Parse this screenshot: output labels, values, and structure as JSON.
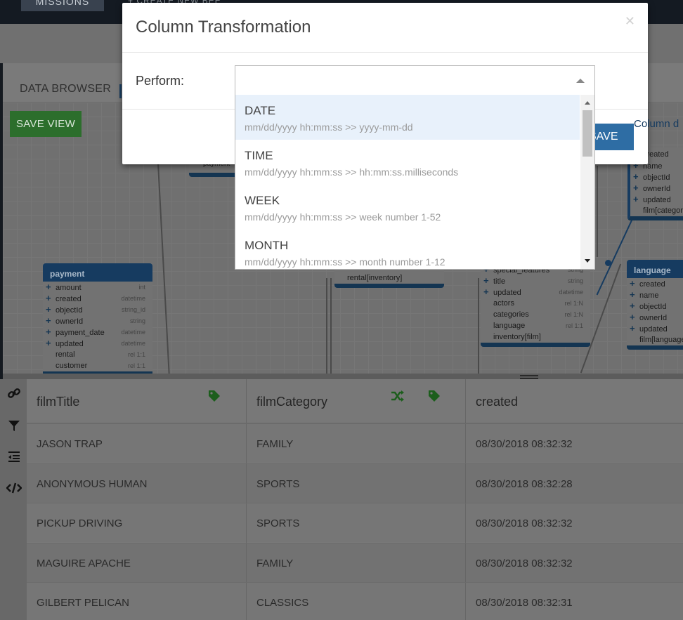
{
  "app": {
    "nav_missions": "MISSIONS",
    "nav_create": "+ CREATE NEW BEE",
    "tab_data_browser": "DATA BROWSER",
    "save_view": "SAVE VIEW"
  },
  "diagram": {
    "payment": {
      "title": "payment",
      "fields": [
        {
          "name": "amount",
          "type": "int",
          "plus": true
        },
        {
          "name": "created",
          "type": "datetime",
          "plus": true
        },
        {
          "name": "objectId",
          "type": "string_id",
          "plus": true
        },
        {
          "name": "ownerId",
          "type": "string",
          "plus": true
        },
        {
          "name": "payment_date",
          "type": "datetime",
          "plus": true
        },
        {
          "name": "updated",
          "type": "datetime",
          "plus": true
        },
        {
          "name": "rental",
          "type": "rel 1:1",
          "plus": false
        },
        {
          "name": "customer",
          "type": "rel 1:1",
          "plus": false
        }
      ]
    },
    "film": {
      "fields": [
        {
          "name": "special_features",
          "type": "string",
          "plus": true
        },
        {
          "name": "title",
          "type": "string",
          "plus": true
        },
        {
          "name": "updated",
          "type": "datetime",
          "plus": true
        },
        {
          "name": "actors",
          "type": "rel 1:N",
          "plus": false
        },
        {
          "name": "categories",
          "type": "rel 1:N",
          "plus": false
        },
        {
          "name": "language",
          "type": "rel 1:1",
          "plus": false
        },
        {
          "name": "inventory[film]",
          "type": "",
          "plus": false
        }
      ]
    },
    "mid_fragment": "rental[inventory]",
    "category": {
      "fields": [
        {
          "name": "created",
          "plus": false
        },
        {
          "name": "name",
          "plus": true
        },
        {
          "name": "objectId",
          "plus": true
        },
        {
          "name": "ownerId",
          "plus": true
        },
        {
          "name": "updated",
          "plus": true
        },
        {
          "name": "film[category]",
          "plus": false
        }
      ]
    },
    "language": {
      "title": "language",
      "fields": [
        {
          "name": "created",
          "plus": true
        },
        {
          "name": "name",
          "plus": true
        },
        {
          "name": "objectId",
          "plus": true
        },
        {
          "name": "ownerId",
          "plus": true
        },
        {
          "name": "updated",
          "plus": true
        },
        {
          "name": "film[language]",
          "plus": false
        }
      ]
    },
    "payment_tag": "payment"
  },
  "table": {
    "columns": [
      {
        "label": "filmTitle"
      },
      {
        "label": "filmCategory"
      },
      {
        "label": "created"
      }
    ],
    "rows": [
      [
        "JASON TRAP",
        "FAMILY",
        "08/30/2018 08:32:32"
      ],
      [
        "ANONYMOUS HUMAN",
        "SPORTS",
        "08/30/2018 08:32:28"
      ],
      [
        "PICKUP DRIVING",
        "SPORTS",
        "08/30/2018 08:32:32"
      ],
      [
        "MAGUIRE APACHE",
        "FAMILY",
        "08/30/2018 08:32:32"
      ],
      [
        "GILBERT PELICAN",
        "CLASSICS",
        "08/30/2018 08:32:31"
      ]
    ]
  },
  "modal": {
    "title": "Column Transformation",
    "perform_label": "Perform:",
    "select_value": "",
    "save_label": "SAVE",
    "column_link": "Column d",
    "options": [
      {
        "title": "DATE",
        "sub": "mm/dd/yyyy hh:mm:ss >> yyyy-mm-dd",
        "highlighted": true
      },
      {
        "title": "TIME",
        "sub": "mm/dd/yyyy hh:mm:ss >> hh:mm:ss.milliseconds",
        "highlighted": false
      },
      {
        "title": "WEEK",
        "sub": "mm/dd/yyyy hh:mm:ss >> week number 1-52",
        "highlighted": false
      },
      {
        "title": "MONTH",
        "sub": "mm/dd/yyyy hh:mm:ss >> month number 1-12",
        "highlighted": false
      }
    ]
  },
  "colors": {
    "accent_blue": "#2e6da4",
    "save_view_green": "#2c6e2c",
    "option_highlight": "#e8f1fb"
  }
}
